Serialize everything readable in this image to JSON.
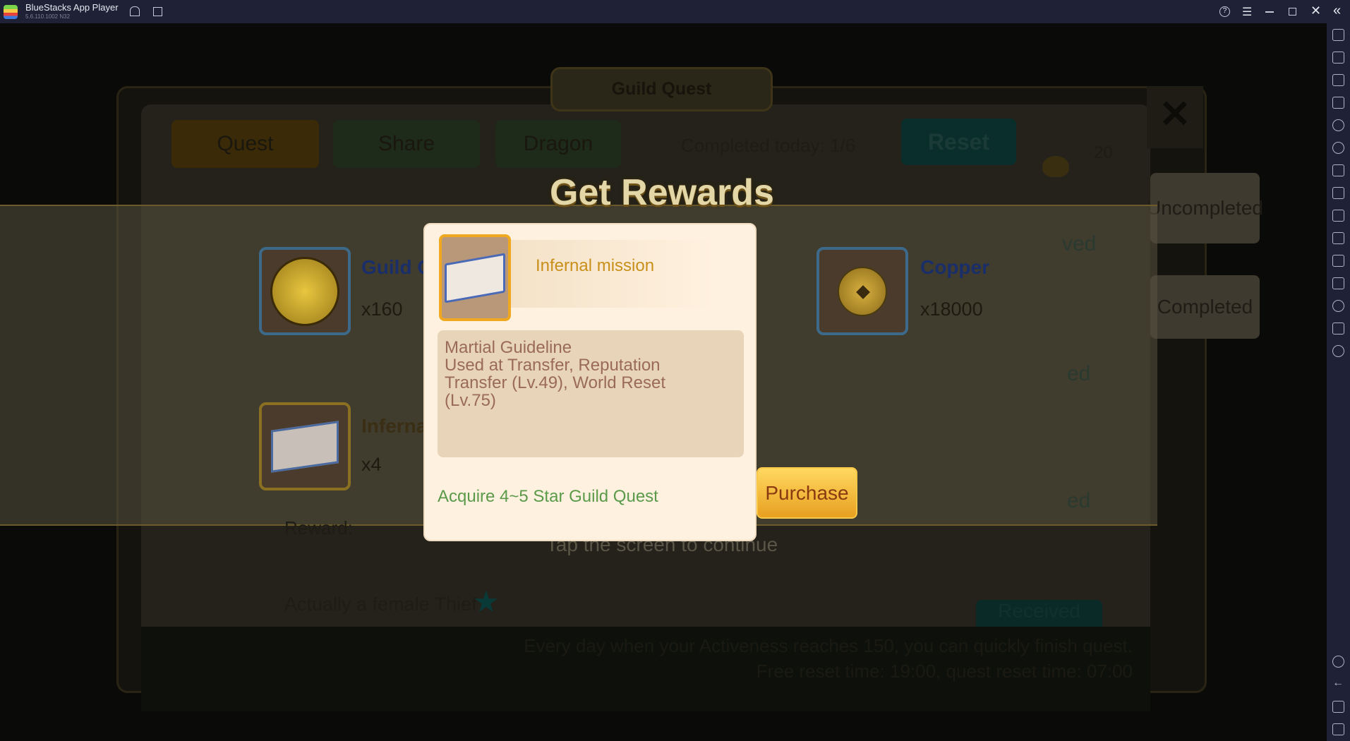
{
  "titlebar": {
    "app_name": "BlueStacks App Player",
    "version": "5.6.110.1002  N32",
    "icons": [
      "home-icon",
      "multi-instance-icon",
      "help-icon",
      "menu-icon",
      "minimize-icon",
      "restore-icon",
      "close-icon",
      "collapse-sidebar-icon"
    ]
  },
  "sidebar": {
    "icons": [
      "fullscreen-icon",
      "volume-icon",
      "media-icon",
      "keyboard-icon",
      "macro-icon",
      "sync-icon",
      "gamepad-icon",
      "record-icon",
      "screenshot-icon",
      "folder-icon",
      "apk-icon",
      "eco-mode-icon",
      "location-icon",
      "layers-icon",
      "rotate-icon"
    ],
    "bottom_icons": [
      "settings-icon",
      "back-icon",
      "home-icon",
      "recents-icon"
    ]
  },
  "game": {
    "window_title": "Guild Quest",
    "tabs": [
      "Quest",
      "Share",
      "Dragon"
    ],
    "completed_today": "Completed today: 1/6",
    "reset_label": "Reset",
    "ingot_count": "20",
    "side_tabs": [
      "Uncompleted",
      "Completed"
    ],
    "get_rewards": "Get Rewards",
    "rewards": [
      {
        "name": "Guild C",
        "qty": "x160",
        "icon": "guild-coin-icon"
      },
      {
        "name": "Copper",
        "qty": "x18000",
        "icon": "copper-coins-icon"
      },
      {
        "name": "Inferna",
        "qty": "x4",
        "icon": "book-icon"
      }
    ],
    "row_status": [
      "ved",
      "ed",
      "ed"
    ],
    "purchase_label": "Purchase",
    "reward_label": "Reward:",
    "tap_continue": "Tap the screen to continue",
    "quest_name": "Actually a female Thief",
    "received_label": "Received",
    "footer_lines": [
      "Every day when your Activeness reaches 150, you can quickly finish quest.",
      "Free reset time: 19:00, quest reset time: 07:00"
    ]
  },
  "popup": {
    "item_title": "Infernal mission",
    "desc_lines": [
      "Martial Guideline",
      "Used at Transfer, Reputation",
      "Transfer (Lv.49), World Reset",
      "(Lv.75)"
    ],
    "source": "Acquire 4~5 Star Guild Quest"
  },
  "colors": {
    "titlebar": "#1f2137",
    "popup_bg": "#fff1df",
    "item_title": "#c8901a",
    "desc": "#9a6a5a",
    "source": "#5a9a4a",
    "purchase": "#f2b53a"
  }
}
